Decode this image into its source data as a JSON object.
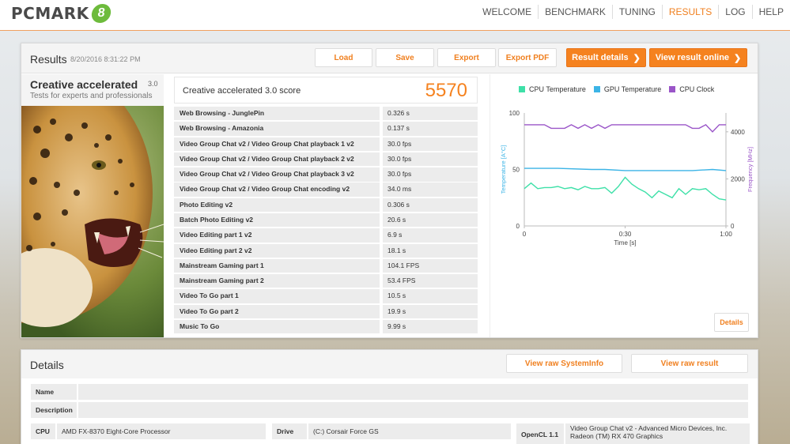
{
  "header": {
    "logo_text": "PCMARK",
    "logo_badge": "8",
    "nav": [
      "WELCOME",
      "BENCHMARK",
      "TUNING",
      "RESULTS",
      "LOG",
      "HELP"
    ],
    "active_nav": "RESULTS"
  },
  "results": {
    "title": "Results",
    "date": "8/20/2016 8:31:22 PM",
    "buttons": {
      "load": "Load",
      "save": "Save",
      "export": "Export",
      "export_pdf": "Export PDF",
      "result_details": "Result details",
      "view_online": "View result online"
    },
    "benchmark": {
      "name": "Creative accelerated",
      "version": "3.0",
      "subtitle": "Tests for experts and professionals"
    },
    "score_label": "Creative accelerated 3.0 score",
    "score_value": "5570",
    "tests": [
      {
        "name": "Web Browsing - JunglePin",
        "value": "0.326 s"
      },
      {
        "name": "Web Browsing - Amazonia",
        "value": "0.137 s"
      },
      {
        "name": "Video Group Chat v2 / Video Group Chat playback 1 v2",
        "value": "30.0 fps"
      },
      {
        "name": "Video Group Chat v2 / Video Group Chat playback 2 v2",
        "value": "30.0 fps"
      },
      {
        "name": "Video Group Chat v2 / Video Group Chat playback 3 v2",
        "value": "30.0 fps"
      },
      {
        "name": "Video Group Chat v2 / Video Group Chat encoding v2",
        "value": "34.0 ms"
      },
      {
        "name": "Photo Editing v2",
        "value": "0.306 s"
      },
      {
        "name": "Batch Photo Editing v2",
        "value": "20.6 s"
      },
      {
        "name": "Video Editing part 1 v2",
        "value": "6.9 s"
      },
      {
        "name": "Video Editing part 2 v2",
        "value": "18.1 s"
      },
      {
        "name": "Mainstream Gaming part 1",
        "value": "104.1 FPS"
      },
      {
        "name": "Mainstream Gaming part 2",
        "value": "53.4 FPS"
      },
      {
        "name": "Video To Go part 1",
        "value": "10.5 s"
      },
      {
        "name": "Video To Go part 2",
        "value": "19.9 s"
      },
      {
        "name": "Music To Go",
        "value": "9.99 s"
      }
    ],
    "details_button": "Details"
  },
  "chart_data": {
    "type": "line",
    "legend": [
      "CPU Temperature",
      "GPU Temperature",
      "CPU Clock"
    ],
    "colors": {
      "cpu_temp": "#3ee0a8",
      "gpu_temp": "#3cb4e6",
      "cpu_clock": "#9a55c8"
    },
    "x_ticks": [
      "0",
      "0:30",
      "1:00"
    ],
    "xlabel": "Time [s]",
    "ylabel_left": "Temperature [A°C]",
    "ylabel_right": "Frequency [MHz]",
    "y_left_ticks": [
      "0",
      "50",
      "100"
    ],
    "y_right_ticks": [
      "0",
      "2000",
      "4000"
    ],
    "xlim": [
      0,
      60
    ],
    "ylim_left": [
      0,
      100
    ],
    "ylim_right": [
      0,
      4800
    ],
    "series": [
      {
        "name": "CPU Temperature",
        "axis": "left",
        "x": [
          0,
          2,
          4,
          6,
          8,
          10,
          12,
          14,
          16,
          18,
          20,
          22,
          24,
          26,
          28,
          30,
          32,
          34,
          36,
          38,
          40,
          42,
          44,
          46,
          48,
          50,
          52,
          54,
          56,
          58,
          60
        ],
        "y": [
          33,
          38,
          33,
          34,
          34,
          35,
          33,
          34,
          32,
          35,
          33,
          33,
          34,
          29,
          35,
          43,
          37,
          33,
          30,
          25,
          31,
          28,
          25,
          33,
          28,
          33,
          32,
          33,
          28,
          24,
          23
        ]
      },
      {
        "name": "GPU Temperature",
        "axis": "left",
        "x": [
          0,
          10,
          20,
          24,
          30,
          40,
          50,
          56,
          60
        ],
        "y": [
          51,
          51,
          50,
          50,
          49,
          49,
          49,
          50,
          49
        ]
      },
      {
        "name": "CPU Clock",
        "axis": "right",
        "x": [
          0,
          6,
          8,
          10,
          12,
          14,
          16,
          18,
          20,
          22,
          24,
          26,
          28,
          30,
          40,
          48,
          50,
          52,
          54,
          56,
          58,
          60
        ],
        "y": [
          4300,
          4300,
          4150,
          4150,
          4150,
          4300,
          4150,
          4300,
          4150,
          4300,
          4150,
          4300,
          4300,
          4300,
          4300,
          4300,
          4150,
          4150,
          4300,
          4000,
          4300,
          4300
        ]
      }
    ]
  },
  "details": {
    "title": "Details",
    "view_raw_systeminfo": "View raw SystemInfo",
    "view_raw_result": "View raw result",
    "name_label": "Name",
    "description_label": "Description",
    "cpu_label": "CPU",
    "cpu_value": "AMD FX-8370 Eight-Core Processor",
    "drive_label": "Drive",
    "drive_value": "(C:) Corsair Force GS",
    "opencl_label": "OpenCL 1.1",
    "opencl_line1": "Video Group Chat v2 - Advanced Micro Devices, Inc.",
    "opencl_line2": "Radeon (TM) RX 470 Graphics"
  }
}
